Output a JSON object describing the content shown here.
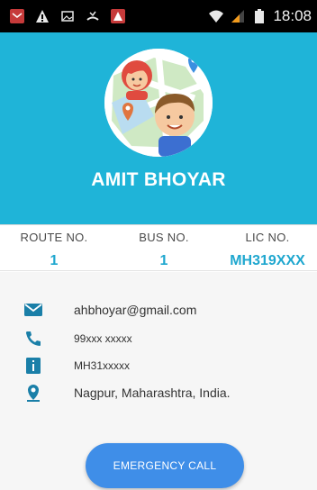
{
  "status_bar": {
    "time": "18:08",
    "left_icons": [
      "message-icon",
      "warning-icon",
      "image-icon",
      "missed-call-icon",
      "app-notification-icon"
    ],
    "right_icons": [
      "wifi-icon",
      "signal-icon",
      "battery-icon"
    ]
  },
  "profile": {
    "name": "AMIT BHOYAR",
    "avatar": "users-on-map-avatar-icon"
  },
  "info_bar": {
    "columns": [
      {
        "label": "ROUTE NO.",
        "value": "1"
      },
      {
        "label": "BUS NO.",
        "value": "1"
      },
      {
        "label": "LIC NO.",
        "value": "MH319XXX"
      }
    ]
  },
  "details": {
    "email": "ahbhoyar@gmail.com",
    "phone": "99xxx xxxxx",
    "license": "MH31xxxxx",
    "address": "Nagpur, Maharashtra, India."
  },
  "actions": {
    "emergency_label": "EMERGENCY CALL"
  },
  "colors": {
    "header": "#1fb4d8",
    "accent_text": "#1fa7cf",
    "icons": "#1a7fa8",
    "button": "#3f8ee8",
    "details_bg": "#f6f6f6"
  }
}
